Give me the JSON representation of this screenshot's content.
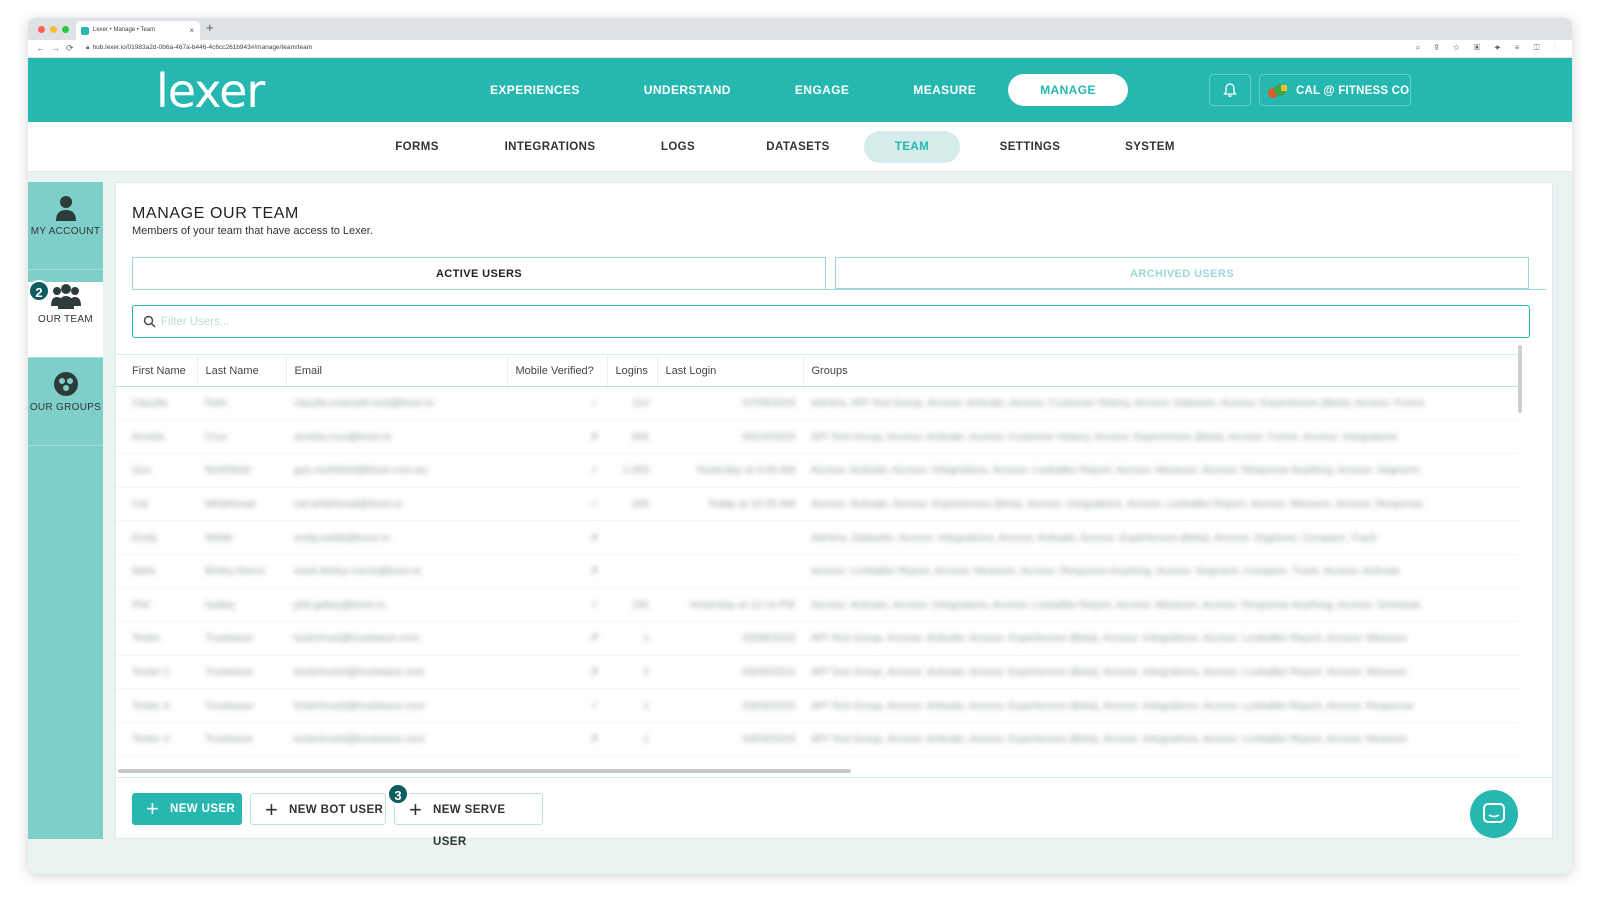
{
  "browser": {
    "tab_title": "Lexer • Manage • Team",
    "new_tab": "+",
    "url": "hub.lexer.io/01983a2d-0b6a-467a-b446-4c6cc261b943#/manage/team/team"
  },
  "header": {
    "logo": "lexer",
    "nav": [
      "EXPERIENCES",
      "UNDERSTAND",
      "ENGAGE",
      "MEASURE",
      "MANAGE"
    ],
    "active_nav": "MANAGE",
    "account_label": "CAL @ FITNESS CO"
  },
  "subnav": {
    "items": [
      "FORMS",
      "INTEGRATIONS",
      "LOGS",
      "DATASETS",
      "TEAM",
      "SETTINGS",
      "SYSTEM"
    ],
    "active": "TEAM"
  },
  "sidebar": {
    "items": [
      {
        "label": "MY ACCOUNT"
      },
      {
        "label": "OUR TEAM",
        "badge": "2"
      },
      {
        "label": "OUR GROUPS"
      }
    ]
  },
  "main": {
    "title": "MANAGE OUR TEAM",
    "subtitle": "Members of your team that have access to Lexer.",
    "tabs": [
      "ACTIVE USERS",
      "ARCHIVED USERS"
    ],
    "filter_placeholder": "Filter Users...",
    "table": {
      "columns": [
        "First Name",
        "Last Name",
        "Email",
        "Mobile Verified?",
        "Logins",
        "Last Login",
        "Groups"
      ],
      "rows": [
        [
          "Claudia",
          "Park",
          "claudia.example.test@lexer.io",
          "✓",
          "114",
          "07/09/2023",
          "Admins, API Test Group, Access: Activate, Access: Customer History, Access: Datasets, Access: Experiences (Beta), Access: Forms"
        ],
        [
          "Amelia",
          "Cruz",
          "amelia.cruz@lexer.io",
          "✗",
          "306",
          "05/24/2023",
          "API Test Group, Access: Activate, Access: Customer History, Access: Experiences (Beta), Access: Forms, Access: Integrations"
        ],
        [
          "Gus",
          "Northfield",
          "gus.northfield@lexer.com.au",
          "✓",
          "1,053",
          "Yesterday at 4:05 AM",
          "Access: Activate, Access: Integrations, Access: Lookalike Report, Access: Measure, Access: Response Anything, Access: Segment"
        ],
        [
          "Cal",
          "Whitehead",
          "cal.whitehead@lexer.io",
          "✓",
          "205",
          "Today at 10:25 AM",
          "Access: Activate, Access: Experiences (Beta), Access: Integrations, Access: Lookalike Report, Access: Measure, Access: Response"
        ],
        [
          "Emily",
          "Webb",
          "emily.webb@lexer.io",
          "✗",
          "",
          "",
          "Admins, Datasets, Access: Integrations, Access: Activate, Access: Experiences (Beta), Access: Segment, Compare, Track"
        ],
        [
          "Mark",
          "Binley-Norris",
          "mark.binley-norris@lexer.io",
          "✗",
          "",
          "",
          "Access: Lookalike Report, Access: Measure, Access: Response Anything, Access: Segment, Compare, Track, Access: Activate"
        ],
        [
          "Phil",
          "Gatley",
          "phil.gatley@lexer.io",
          "✓",
          "195",
          "Yesterday at 12:14 PM",
          "Access: Activate, Access: Integrations, Access: Lookalike Report, Access: Measure, Access: Response Anything, Access: Schedule"
        ],
        [
          "Tester",
          "Trustwave",
          "testertrust@trustwave.com",
          "✗",
          "1",
          "03/08/2023",
          "API Test Group, Access: Activate, Access: Experiences (Beta), Access: Integrations, Access: Lookalike Report, Access: Measure"
        ],
        [
          "Tester 2",
          "Trustwave",
          "testertrust2@trustwave.com",
          "✗",
          "4",
          "03/09/2023",
          "API Test Group, Access: Activate, Access: Experiences (Beta), Access: Integrations, Access: Lookalike Report, Access: Measure"
        ],
        [
          "Tester 3",
          "Trustwave",
          "testertrust3@trustwave.com",
          "✓",
          "1",
          "03/03/2023",
          "API Test Group, Access: Activate, Access: Experiences (Beta), Access: Integrations, Access: Lookalike Report, Access: Response"
        ],
        [
          "Tester 4",
          "Trustwave",
          "testertrust4@trustwave.com",
          "✗",
          "1",
          "03/03/2023",
          "API Test Group, Access: Activate, Access: Experiences (Beta), Access: Integrations, Access: Lookalike Report, Access: Measure"
        ]
      ]
    },
    "buttons": {
      "new_user": "NEW USER",
      "new_bot_user": "NEW BOT USER",
      "new_serve_user": "NEW SERVE USER",
      "serve_badge": "3"
    }
  },
  "colors": {
    "brand": "#26b8b0",
    "sidebar": "#7ecfca",
    "badge": "#0d5c5e"
  }
}
